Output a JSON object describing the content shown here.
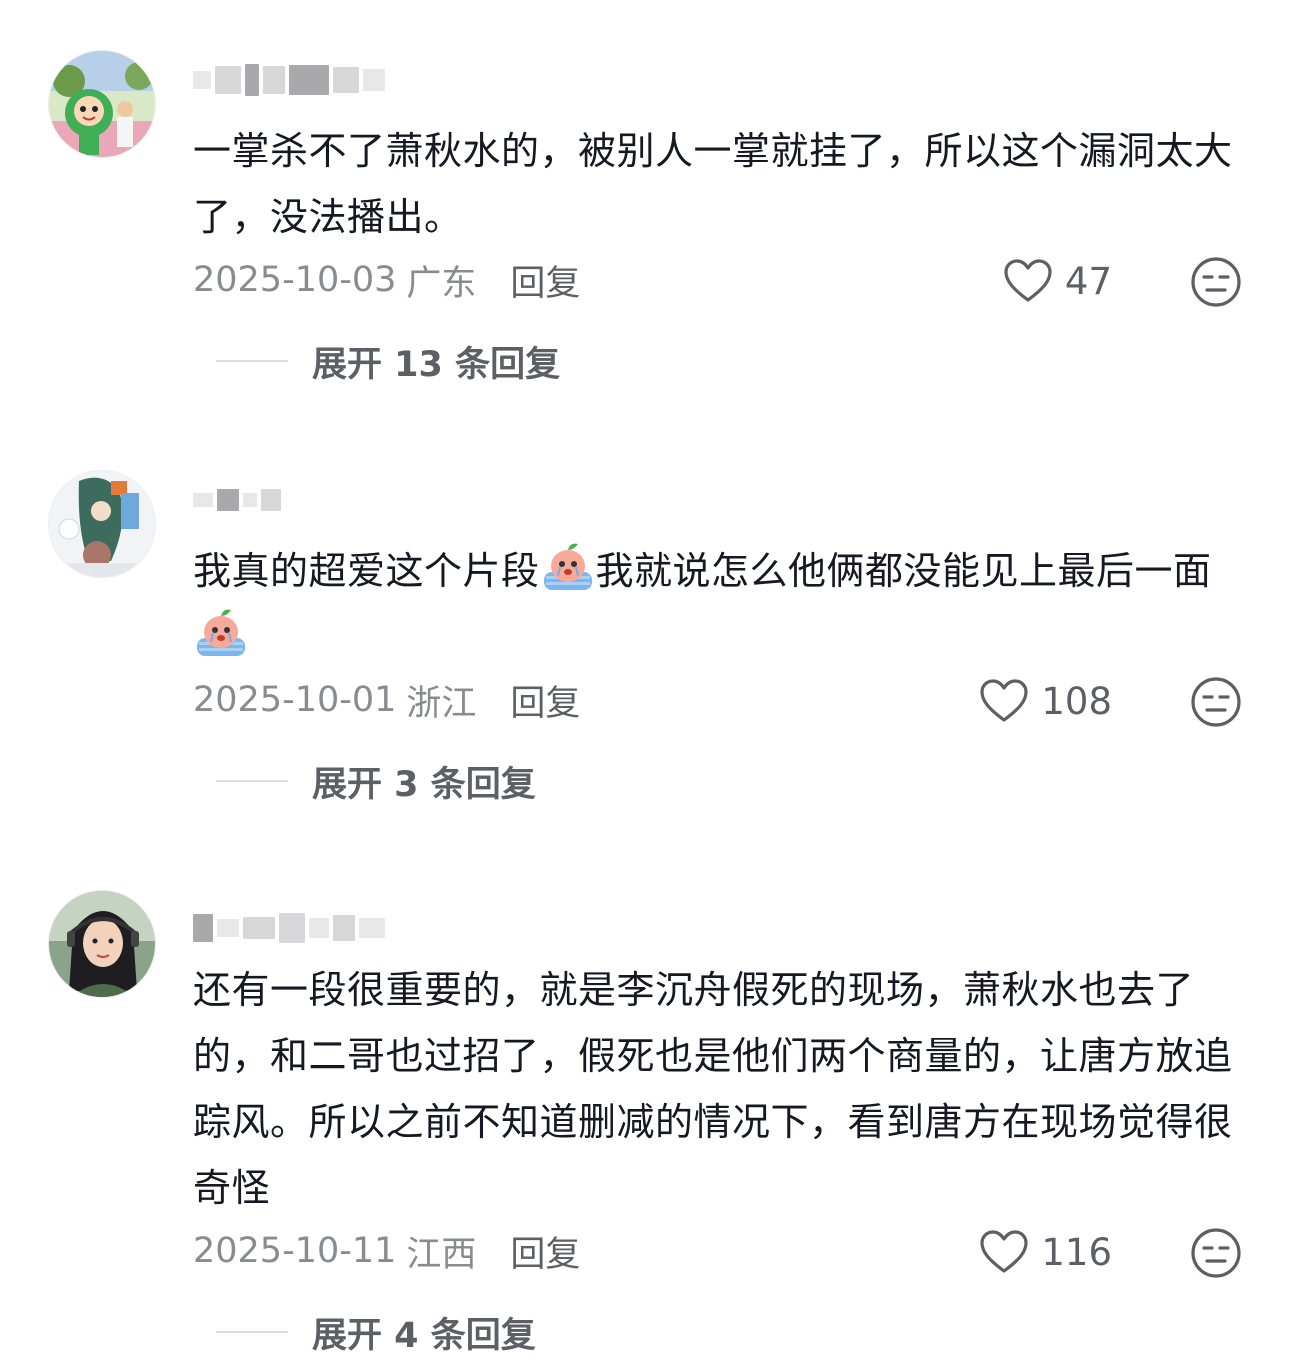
{
  "comments": [
    {
      "text_parts": [
        "一掌杀不了萧秋水的，被别人一掌就挂了，所以这个漏洞太大了，没法播出。"
      ],
      "date": "2025-10-03",
      "region": "广东",
      "reply_label": "回复",
      "likes": "47",
      "expand_label": "展开 13 条回复",
      "avatar_icon": "cartoon-mascot-avatar"
    },
    {
      "text_parts": [
        "我真的超爱这个片段",
        "我就说怎么他俩都没能见上最后一面"
      ],
      "emoji": "crying-peach-emoji",
      "date": "2025-10-01",
      "region": "浙江",
      "reply_label": "回复",
      "likes": "108",
      "expand_label": "展开 3 条回复",
      "avatar_icon": "anime-art-avatar"
    },
    {
      "text_parts": [
        "还有一段很重要的，就是李沉舟假死的现场，萧秋水也去了的，和二哥也过招了，假死也是他们两个商量的，让唐方放追踪风。所以之前不知道删减的情况下，看到唐方在现场觉得很奇怪"
      ],
      "date": "2025-10-11",
      "region": "江西",
      "reply_label": "回复",
      "likes": "116",
      "expand_label": "展开 4 条回复",
      "avatar_icon": "portrait-photo-avatar"
    }
  ],
  "colors": {
    "text": "#161823",
    "meta": "#8a8b91",
    "action": "#5e5f66"
  }
}
